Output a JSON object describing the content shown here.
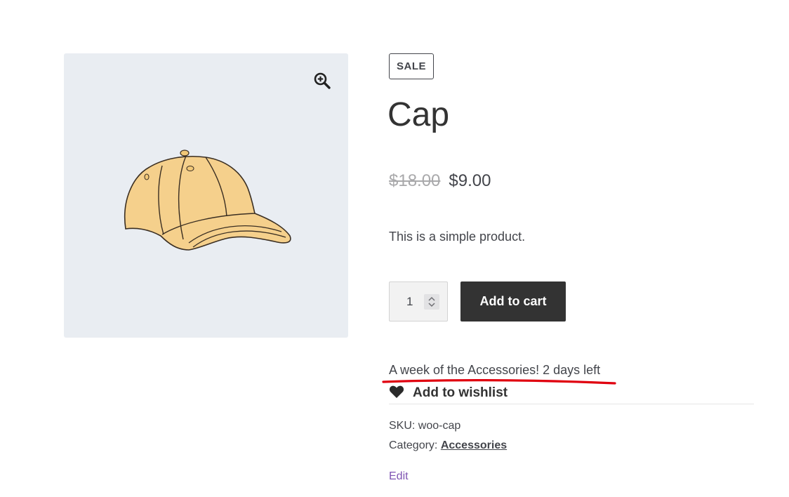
{
  "product": {
    "sale_badge": "SALE",
    "title": "Cap",
    "regular_price": "$18.00",
    "sale_price": "$9.00",
    "short_description": "This is a simple product.",
    "quantity": "1",
    "add_to_cart_label": "Add to cart",
    "promo_text": "A week of the Accessories! 2 days left",
    "wishlist_label": "Add to wishlist",
    "sku_label": "SKU:",
    "sku_value": "woo-cap",
    "category_label": "Category:",
    "category_value": "Accessories",
    "edit_label": "Edit"
  },
  "icons": {
    "zoom": "magnifier-plus-icon",
    "wishlist": "heart-icon",
    "stepper": "chevron-up-down-icon"
  },
  "colors": {
    "gallery_bg": "#e9edf2",
    "button_bg": "#333333",
    "edit_link": "#7f54b3",
    "promo_underline": "#e0000f",
    "cap_fill": "#f5d08c"
  }
}
